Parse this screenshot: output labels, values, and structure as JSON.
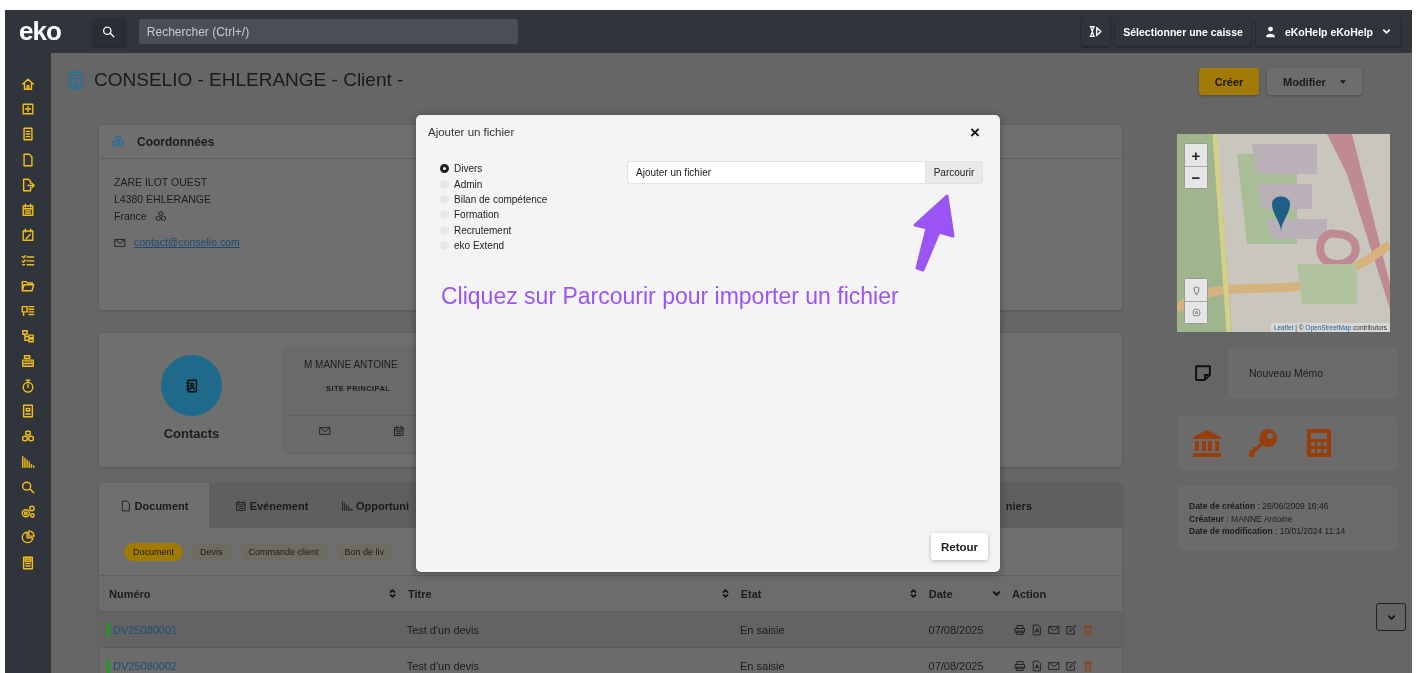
{
  "topbar": {
    "logo": "eko",
    "search": {
      "placeholder": "Rechercher (Ctrl+/)"
    },
    "register_button": "Sélectionner une caisse",
    "user_menu": "eKoHelp eKoHelp"
  },
  "page": {
    "title": "CONSELIO - EHLERANGE - Client -"
  },
  "actions": [
    {
      "label": "Créer",
      "kind": "primary"
    },
    {
      "label": "Modifier",
      "kind": "dropdown"
    }
  ],
  "address_card": {
    "title": "Coordonnées",
    "lines": [
      "ZARE ILOT OUEST",
      "L4380 EHLERANGE"
    ],
    "country": "France",
    "email": "contact@conselio.com"
  },
  "contacts_card": {
    "label": "Contacts",
    "contact": {
      "name": "M MANNE ANTOINE",
      "site": "SITE PRINCIPAL"
    }
  },
  "tabs": [
    {
      "label": "Document",
      "selected": true
    },
    {
      "label": "Evénement",
      "selected": false
    },
    {
      "label": "Opportuni",
      "selected": false
    },
    {
      "label": "niers",
      "selected": false
    }
  ],
  "filters": [
    {
      "label": "Document",
      "selected": true
    },
    {
      "label": "Devis",
      "selected": false
    },
    {
      "label": "Commande client",
      "selected": false
    },
    {
      "label": "Bon de liv",
      "selected": false
    }
  ],
  "table": {
    "columns": [
      {
        "label": "Numéro",
        "sortable": true,
        "sorted": false
      },
      {
        "label": "Titre",
        "sortable": true,
        "sorted": false
      },
      {
        "label": "Etat",
        "sortable": true,
        "sorted": false
      },
      {
        "label": "Date",
        "sortable": true,
        "sorted": true
      },
      {
        "label": "Action",
        "sortable": false,
        "sorted": false
      }
    ],
    "rows": [
      {
        "number": "DV25080001",
        "title": "Test d'un devis",
        "status": "En saisie",
        "date": "07/08/2025"
      },
      {
        "number": "DV25080002",
        "title": "Test d'un devis",
        "status": "En saisie",
        "date": "07/08/2025"
      }
    ]
  },
  "map": {
    "zoom_in": "+",
    "zoom_out": "−",
    "attribution": {
      "link_1": "Leaflet",
      "middle": "| ©",
      "link_2": "OpenStreetMap",
      "tail": "contributors"
    }
  },
  "memo": {
    "label": "Nouveau Mémo"
  },
  "info": [
    "**Date de création** : 26/06/2009 16:46",
    "**Créateur** : MANNE Antoine",
    "**Date de modification** : 10/01/2024 11:14"
  ],
  "modal": {
    "title": "Ajouter un fichier",
    "close": "×",
    "categories": [
      {
        "label": "Divers",
        "selected": true
      },
      {
        "label": "Admin",
        "selected": false
      },
      {
        "label": "Bilan de compétence",
        "selected": false
      },
      {
        "label": "Formation",
        "selected": false
      },
      {
        "label": "Recrutement",
        "selected": false
      },
      {
        "label": "eko Extend",
        "selected": false
      }
    ],
    "file_field": {
      "placeholder": "Ajouter un fichier"
    },
    "browse_button": "Parcourir",
    "hint": "Cliquez sur Parcourir pour importer un fichier",
    "back_button": "Retour"
  }
}
